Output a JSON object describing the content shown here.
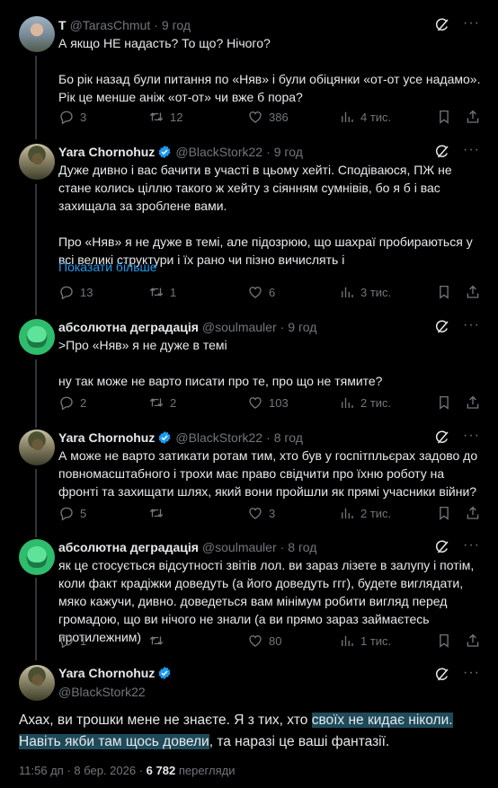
{
  "tweets": [
    {
      "name": "T",
      "handle": "@TarasChmut",
      "dot": "·",
      "time": "9 год",
      "text": "А якщо НЕ надасть? То що? Нічого?\n\nБо рік назад були питання по «Няв» і були обіцянки «от-от усе надамо». Рік це менше аніж «от-от» чи вже б пора?",
      "replies": "3",
      "reposts": "12",
      "likes": "386",
      "views": "4 тис."
    },
    {
      "name": "Yara Chornohuz",
      "handle": "@BlackStork22",
      "dot": "·",
      "time": "9 год",
      "text": "Дуже дивно і вас бачити в участі в цьому хейті. Сподіваюся, ПЖ не стане колись ціллю такого ж хейту з сіянням сумнівів, бо я б і вас захищала за зроблене вами.\n\nПро «Няв» я не дуже в темі, але підозрюю, що шахраї пробираються у всі великі структури і їх рано чи пізно вичислять і",
      "show_more": "Показати більше",
      "replies": "13",
      "reposts": "1",
      "likes": "6",
      "views": "3 тис."
    },
    {
      "name": "абсолютна деградація",
      "handle": "@soulmauler",
      "dot": "·",
      "time": "9 год",
      "text": ">Про «Няв» я не дуже в темі\n\nну так може не варто писати про те, про що не тямите?",
      "replies": "2",
      "reposts": "2",
      "likes": "103",
      "views": "2 тис."
    },
    {
      "name": "Yara Chornohuz",
      "handle": "@BlackStork22",
      "dot": "·",
      "time": "8 год",
      "text": "А може не варто затикати ротам тим, хто був у госпітпльєрах задово до повномасштабного і трохи має право свідчити про їхню роботу на фронті та захищати шлях, який вони пройшли як прямі учасники війни?",
      "replies": "5",
      "reposts": "",
      "likes": "3",
      "views": "2 тис."
    },
    {
      "name": "абсолютна деградація",
      "handle": "@soulmauler",
      "dot": "·",
      "time": "8 год",
      "text": "як це стосується відсутності звітів лол. ви зараз лізете в залупу і потім, коли факт крадіжки доведуть (а його доведуть ггг), будете виглядати, мяко кажучи, дивно. доведеться вам мінімум робити вигляд перед громадою, що ви нічого не знали (а ви прямо зараз займаєтесь протилежним)",
      "replies": "1",
      "reposts": "",
      "likes": "80",
      "views": "1 тис."
    }
  ],
  "main": {
    "name": "Yara Chornohuz",
    "handle": "@BlackStork22",
    "text_before": "Ахах, ви трошки мене не знаєте. Я з тих, хто ",
    "text_highlight": "своїх не кидає ніколи. Навіть якби там щось довели",
    "text_after": ", та наразі це ваші фантазії.",
    "time": "11:56 дп · 8 бер. 2026 · ",
    "views": "6 782",
    "views_label": " перегляди"
  },
  "colors": {
    "background": "#000000",
    "text": "#e7e9ea",
    "muted": "#71767b",
    "link": "#1d9bf0",
    "verified": "#1d9bf0",
    "highlight": "#1e4a5a",
    "thread_line": "#333639"
  },
  "icons": [
    "reply-icon",
    "repost-icon",
    "like-icon",
    "views-icon",
    "bookmark-icon",
    "share-icon",
    "grok-icon",
    "more-icon",
    "verified-icon"
  ]
}
